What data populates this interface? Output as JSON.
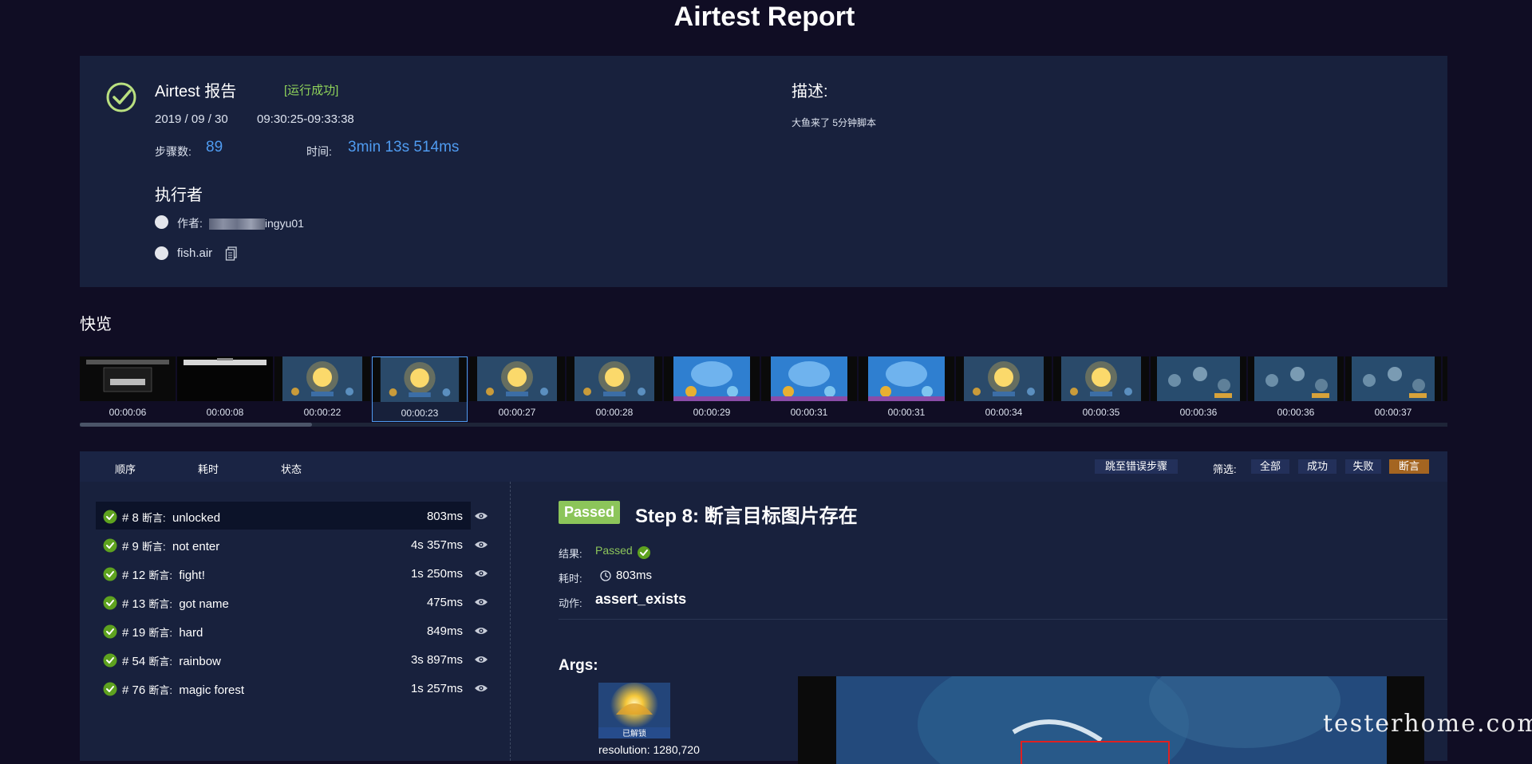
{
  "header": {
    "title": "Airtest Report"
  },
  "summary": {
    "title": "Airtest 报告",
    "status": "[运行成功]",
    "date": "2019 / 09 / 30",
    "time_range": "09:30:25-09:33:38",
    "steps_label": "步骤数:",
    "steps_value": "89",
    "duration_label": "时间:",
    "duration_value": "3min 13s 514ms",
    "executor_title": "执行者",
    "author_label": "作者:",
    "author_value": "ingyu01",
    "script_name": "fish.air",
    "description_label": "描述:",
    "description_text": "大鱼来了 5分钟脚本",
    "accent_color": "#4f9bf0",
    "success_color": "#8fd35a"
  },
  "overview": {
    "title": "快览",
    "selected_index": 3,
    "scroll_fraction": 0.17,
    "thumbnails": [
      {
        "time": "00:00:06",
        "kind": "dialog"
      },
      {
        "time": "00:00:08",
        "kind": "dark"
      },
      {
        "time": "00:00:22",
        "kind": "ocean-shell"
      },
      {
        "time": "00:00:23",
        "kind": "ocean-shell"
      },
      {
        "time": "00:00:27",
        "kind": "ocean-shell"
      },
      {
        "time": "00:00:28",
        "kind": "ocean-shell"
      },
      {
        "time": "00:00:29",
        "kind": "blue-menu"
      },
      {
        "time": "00:00:31",
        "kind": "blue-menu"
      },
      {
        "time": "00:00:31",
        "kind": "blue-menu"
      },
      {
        "time": "00:00:34",
        "kind": "ocean-shell"
      },
      {
        "time": "00:00:35",
        "kind": "ocean-shell"
      },
      {
        "time": "00:00:36",
        "kind": "ocean-fish"
      },
      {
        "time": "00:00:36",
        "kind": "ocean-fish"
      },
      {
        "time": "00:00:37",
        "kind": "ocean-fish"
      },
      {
        "time": "",
        "kind": "ocean-fish"
      }
    ]
  },
  "toolbar": {
    "sort_order": "顺序",
    "sort_duration": "耗时",
    "sort_status": "状态",
    "jump_error": "跳至错误步骤",
    "filter_label": "筛选:",
    "filters": [
      "全部",
      "成功",
      "失败",
      "断言"
    ],
    "active_filter": "断言"
  },
  "steps": [
    {
      "num": "# 8",
      "kw": "断言:",
      "name": "unlocked",
      "duration": "803ms"
    },
    {
      "num": "# 9",
      "kw": "断言:",
      "name": "not enter",
      "duration": "4s 357ms"
    },
    {
      "num": "# 12",
      "kw": "断言:",
      "name": "fight!",
      "duration": "1s 250ms"
    },
    {
      "num": "# 13",
      "kw": "断言:",
      "name": "got name",
      "duration": "475ms"
    },
    {
      "num": "# 19",
      "kw": "断言:",
      "name": "hard",
      "duration": "849ms"
    },
    {
      "num": "# 54",
      "kw": "断言:",
      "name": "rainbow",
      "duration": "3s 897ms"
    },
    {
      "num": "# 76",
      "kw": "断言:",
      "name": "magic forest",
      "duration": "1s 257ms"
    }
  ],
  "detail": {
    "badge": "Passed",
    "title": "Step 8: 断言目标图片存在",
    "result_label": "结果:",
    "result_value": "Passed",
    "duration_label": "耗时:",
    "duration_value": "803ms",
    "action_label": "动作:",
    "action_value": "assert_exists",
    "args_title": "Args:",
    "arg_image_caption": "已解锁",
    "resolution": "resolution: 1280,720"
  },
  "watermark": "testerhome.com"
}
